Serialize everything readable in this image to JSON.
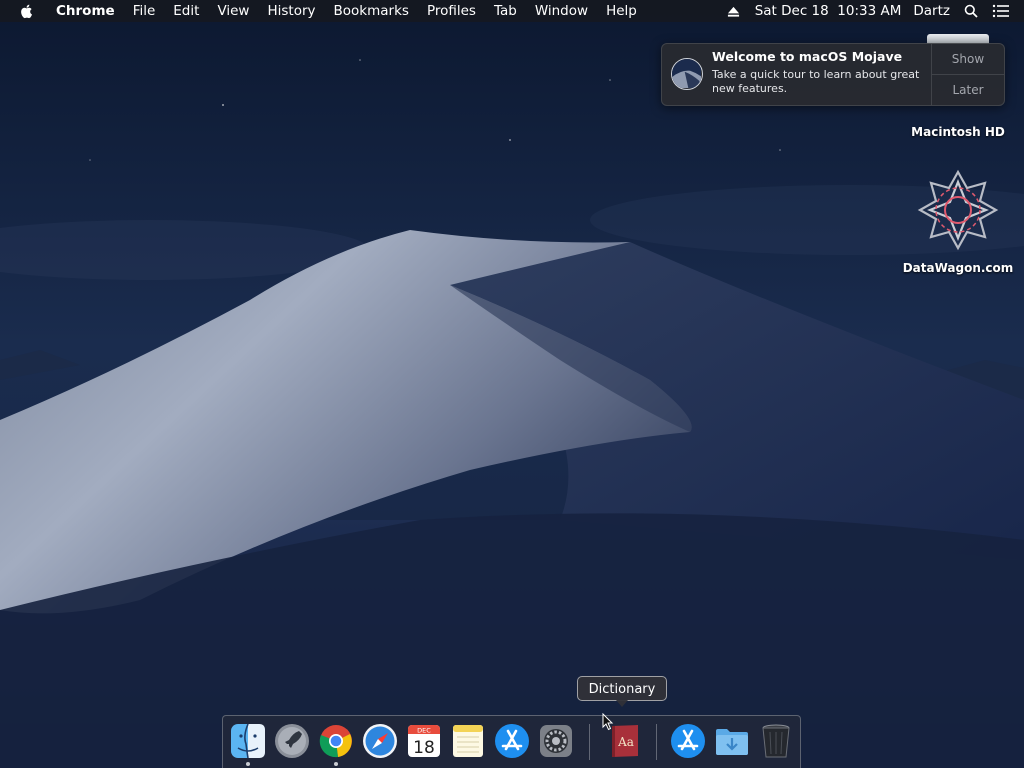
{
  "menubar": {
    "apple_icon": "apple-logo-icon",
    "app_name": "Chrome",
    "menus": [
      "File",
      "Edit",
      "View",
      "History",
      "Bookmarks",
      "Profiles",
      "Tab",
      "Window",
      "Help"
    ],
    "eject_icon": "eject-icon",
    "datetime": "Sat Dec 18  10:33 AM",
    "user": "Dartz",
    "search_icon": "spotlight-search-icon",
    "notification_center_icon": "list-icon"
  },
  "notification": {
    "title": "Welcome to macOS Mojave",
    "body": "Take a quick tour to learn about great new features.",
    "show_label": "Show",
    "later_label": "Later",
    "icon": "mojave-icon"
  },
  "desktop_icons": [
    {
      "label": "Macintosh HD",
      "icon": "hard-drive-icon"
    },
    {
      "label": "DataWagon.com",
      "icon": "datawagon-logo-icon"
    }
  ],
  "dock": {
    "tooltip": "Dictionary",
    "items": [
      {
        "name": "Finder",
        "icon": "finder-icon",
        "running": true
      },
      {
        "name": "Launchpad",
        "icon": "launchpad-icon",
        "running": false
      },
      {
        "name": "Google Chrome",
        "icon": "chrome-icon",
        "running": true
      },
      {
        "name": "Safari",
        "icon": "safari-icon",
        "running": false
      },
      {
        "name": "Calendar",
        "icon": "calendar-icon",
        "running": false,
        "month": "DEC",
        "day": "18"
      },
      {
        "name": "Notes",
        "icon": "notes-icon",
        "running": false
      },
      {
        "name": "App Store",
        "icon": "app-store-icon",
        "running": false
      },
      {
        "name": "System Preferences",
        "icon": "system-preferences-icon",
        "running": false
      },
      {
        "name": "Dictionary",
        "icon": "dictionary-icon",
        "running": false,
        "glyph": "Aa"
      },
      {
        "name": "Applications",
        "icon": "app-store-icon",
        "running": false
      },
      {
        "name": "Downloads",
        "icon": "downloads-folder-icon",
        "running": false
      },
      {
        "name": "Trash",
        "icon": "trash-icon",
        "running": false
      }
    ]
  },
  "colors": {
    "sky_top": "#0e1b36",
    "sky_bottom": "#1c2f52",
    "dune_light": "#9aa6bd",
    "dune_shadow": "#1a2846",
    "dictionary_red": "#a8303a"
  }
}
